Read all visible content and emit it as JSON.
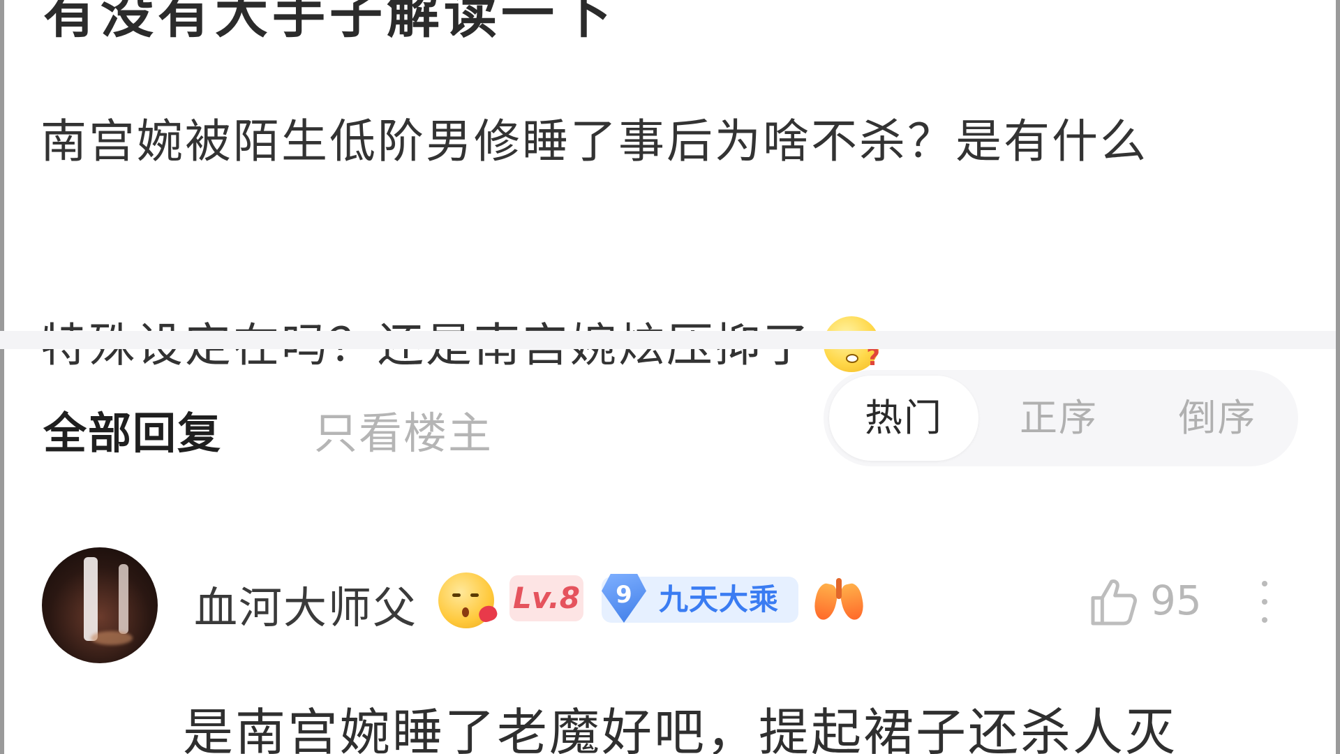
{
  "post": {
    "title": "有没有大手子解读一下",
    "body_line1": "南宫婉被陌生低阶男修睡了事后为啥不杀？是有什么",
    "body_line2": "特殊设定在吗？还是南宫婉炫压抑了",
    "emoji": "thinking-confused-face"
  },
  "replies": {
    "tab_all": "全部回复",
    "tab_op_only": "只看楼主",
    "sort_options": [
      "热门",
      "正序",
      "倒序"
    ],
    "sort_selected": "热门"
  },
  "comment": {
    "username": "血河大师父",
    "username_emoji": "kissing-face-with-heart",
    "level_badge": "Lv.8",
    "rank_number": "9",
    "rank_title": "九天大乘",
    "extra_badge": "lungs-icon",
    "likes": "95",
    "text": "是南宫婉睡了老魔好吧，提起裙子还杀人灭"
  },
  "colors": {
    "background": "#ffffff",
    "divider": "#f4f4f6",
    "level_badge_text": "#e5535d",
    "rank_badge_text": "#3a7cf2"
  }
}
